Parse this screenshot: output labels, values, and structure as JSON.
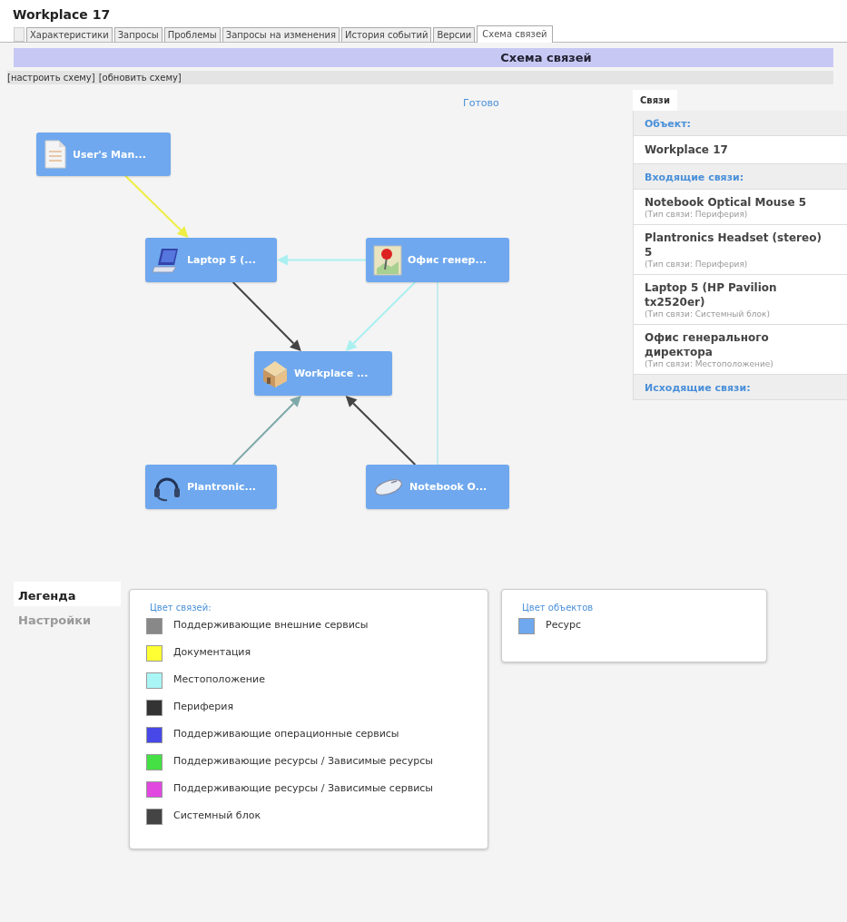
{
  "window": {
    "title": "Workplace 17"
  },
  "tabs": [
    {
      "label": "Характеристики",
      "selected": false
    },
    {
      "label": "Запросы",
      "selected": false
    },
    {
      "label": "Проблемы",
      "selected": false
    },
    {
      "label": "Запросы на изменения",
      "selected": false
    },
    {
      "label": "История событий",
      "selected": false
    },
    {
      "label": "Версии",
      "selected": false
    },
    {
      "label": "Схема связей",
      "selected": true
    }
  ],
  "section_title": "Схема связей",
  "toolbar": [
    "[настроить схему]",
    "[обновить схему]"
  ],
  "diagram": {
    "status": "Готово",
    "nodes": [
      {
        "label": "User's Man...",
        "kind": "document"
      },
      {
        "label": "Laptop 5 (...",
        "kind": "laptop"
      },
      {
        "label": "Офис генер...",
        "kind": "location"
      },
      {
        "label": "Workplace ...",
        "kind": "workplace"
      },
      {
        "label": "Plantronic...",
        "kind": "headset"
      },
      {
        "label": "Notebook O...",
        "kind": "mouse"
      }
    ],
    "edges": [
      {
        "kind": "arrow",
        "color": "#eeee44"
      },
      {
        "kind": "arrow",
        "color": "#aaf0f0"
      },
      {
        "kind": "arrow",
        "color": "#444444"
      },
      {
        "kind": "arrow",
        "color": "#aaf0f0"
      },
      {
        "kind": "line",
        "color": "#c4ecec"
      },
      {
        "kind": "arrow",
        "color": "#7fa8a8"
      },
      {
        "kind": "arrow",
        "color": "#444444"
      }
    ]
  },
  "relations": {
    "tab": {
      "label": "Связи",
      "selected": true
    },
    "object_heading": "Объект:",
    "object": "Workplace 17",
    "incoming_heading": "Входящие связи:",
    "incoming": [
      {
        "name": "Notebook Optical Mouse 5",
        "type": "(Тип связи: Периферия)"
      },
      {
        "name": "Plantronics Headset (stereo) 5",
        "type": "(Тип связи: Периферия)"
      },
      {
        "name": "Laptop 5 (HP Pavilion tx2520er)",
        "type": "(Тип связи: Системный блок)"
      },
      {
        "name": "Офис генерального директора",
        "type": "(Тип связи: Местоположение)"
      }
    ],
    "outgoing_heading": "Исходящие связи:"
  },
  "side_tabs": [
    {
      "label": "Легенда",
      "selected": true
    },
    {
      "label": "Настройки",
      "selected": false
    }
  ],
  "legend": {
    "link_colors_heading": "Цвет связей:",
    "link_colors": [
      {
        "label": "Поддерживающие внешние сервисы",
        "color": "#888888"
      },
      {
        "label": "Документация",
        "color": "#ffff33"
      },
      {
        "label": "Местоположение",
        "color": "#aaf5f5"
      },
      {
        "label": "Периферия",
        "color": "#333333"
      },
      {
        "label": "Поддерживающие операционные сервисы",
        "color": "#4848e8"
      },
      {
        "label": "Поддерживающие ресурсы / Зависимые ресурсы",
        "color": "#44e044"
      },
      {
        "label": "Поддерживающие ресурсы / Зависимые сервисы",
        "color": "#e048e0"
      },
      {
        "label": "Системный блок",
        "color": "#444444"
      }
    ],
    "object_colors_heading": "Цвет объектов",
    "object_colors": [
      {
        "label": "Ресурс",
        "color": "#6fa8ee"
      }
    ]
  }
}
